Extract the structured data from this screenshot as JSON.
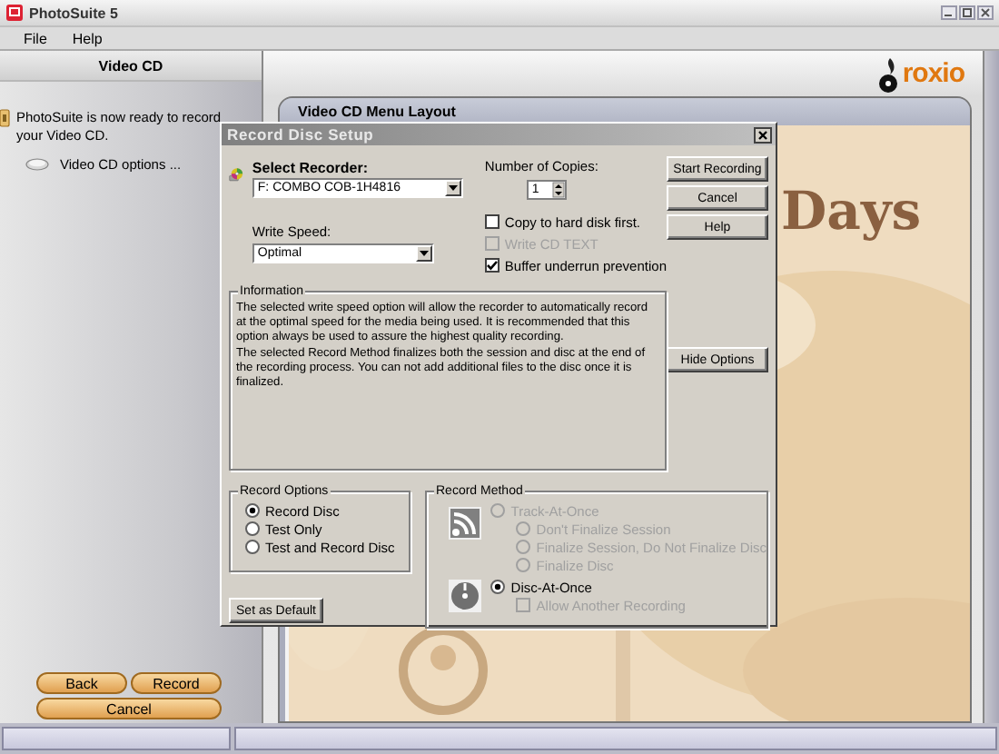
{
  "window": {
    "title": "PhotoSuite 5"
  },
  "menu": [
    {
      "label": "File"
    },
    {
      "label": "Help"
    }
  ],
  "sidebar": {
    "title": "Video CD",
    "message": "PhotoSuite is now ready to record your Video CD.",
    "options": [
      {
        "label": "Video CD options ..."
      }
    ],
    "buttons": [
      {
        "label": "Back"
      },
      {
        "label": "Record"
      },
      {
        "label": "Cancel"
      }
    ]
  },
  "brand": {
    "name": "roxio"
  },
  "preview": {
    "title": "Video CD Menu Layout",
    "heading": "Days"
  },
  "dialog": {
    "title": "Record Disc Setup",
    "recorder": {
      "label": "Select Recorder:",
      "value": "F: COMBO COB-1H4816"
    },
    "write_speed": {
      "label": "Write Speed:",
      "value": "Optimal"
    },
    "copies": {
      "label": "Number of Copies:",
      "value": "1"
    },
    "checkboxes": [
      {
        "label": "Copy to hard disk first.",
        "checked": false,
        "disabled": false
      },
      {
        "label": "Write CD TEXT",
        "checked": false,
        "disabled": true
      },
      {
        "label": "Buffer underrun prevention",
        "checked": true,
        "disabled": false
      }
    ],
    "buttons": [
      {
        "label": "Start Recording"
      },
      {
        "label": "Cancel"
      },
      {
        "label": "Help"
      }
    ],
    "information": {
      "title": "Information",
      "paragraphs": [
        "The selected write speed option will allow the recorder to automatically record at the optimal speed for the media being used. It is recommended that this option always be used to assure the highest quality recording.",
        "The selected Record Method finalizes both the session and disc at the end of the recording process. You can not add additional files to the disc once it is finalized."
      ]
    },
    "hide_options": {
      "label": "Hide Options"
    },
    "record_options": {
      "title": "Record Options",
      "items": [
        {
          "label": "Record Disc",
          "selected": true
        },
        {
          "label": "Test Only",
          "selected": false
        },
        {
          "label": "Test and Record Disc",
          "selected": false
        }
      ]
    },
    "set_default": {
      "label": "Set as Default"
    },
    "record_method": {
      "title": "Record Method",
      "items": [
        {
          "kind": "radio",
          "label": "Track-At-Once",
          "selected": false,
          "disabled": true,
          "children": [
            {
              "kind": "radio",
              "label": "Don't Finalize Session",
              "selected": false,
              "disabled": true
            },
            {
              "kind": "radio",
              "label": "Finalize Session, Do Not Finalize Disc",
              "selected": false,
              "disabled": true
            },
            {
              "kind": "radio",
              "label": "Finalize Disc",
              "selected": false,
              "disabled": true
            }
          ]
        },
        {
          "kind": "radio",
          "label": "Disc-At-Once",
          "selected": true,
          "disabled": false,
          "children": [
            {
              "kind": "checkbox",
              "label": "Allow Another Recording",
              "checked": false,
              "disabled": true
            }
          ]
        }
      ]
    }
  }
}
